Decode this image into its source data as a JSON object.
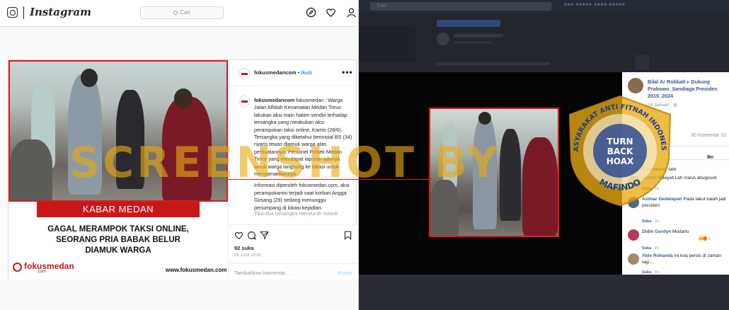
{
  "instagram": {
    "logo": "Instagram",
    "search_placeholder": "Cari",
    "post": {
      "username": "fokusmedancom",
      "follow_label": "Ikuti",
      "more_label": "•••",
      "banner": "KABAR MEDAN",
      "headline_lines": [
        "GAGAL MERAMPOK TAKSI ONLINE,",
        "SEORANG PRIA BABAK BELUR",
        "DIAMUK WARGA"
      ],
      "brand_name": "fokusmedan",
      "brand_tag": ".com",
      "brand_url": "www.fokusmedan.com",
      "caption_user": "fokusmedancom",
      "caption_text": "fokusmedan : Warga Jalan Alfalah Kecamatan Medan Timur lakukan aksi main hakim sendiri terhadap tersangka yang meakukan aksi perampokan taksi online, Kamis (28/6). Tersangka yang diketahui berinisial BS (34) nyaris tewas diamuk warga atas perbuatannya. Personel Polsek Medan Timur yang mendapat laporan adanya amuk warga langsung ke lokasi untuk mengamankannya.",
      "caption_text_2": "Informasi diperoleh fokusmedan.com, aksi perampokanini terjadi saat korban Angga Girsang (29) sedang menunggu penumpang di lokasi kejadian.",
      "caption_fade": "Tiba-tiba tersangka menyuruh masuk",
      "likes": "92 suka",
      "date": "28 JUNI 2018",
      "comment_placeholder": "Tambahkan komentar...",
      "send_label": "Kirim"
    }
  },
  "facebook": {
    "search_placeholder": "Cari",
    "panel": {
      "author": "Bilal Ar Robbah",
      "arrow": "▸",
      "target": "Dukung Prabowo_Sandiaga Presiden 2019_2024",
      "date": "14 Januari",
      "reaction_count": "915",
      "comments_count": "30 Komentar",
      "shares_count": "31",
      "like_label": "Suka",
      "share_label": "Be",
      "more_comments": "Lihat 15 komentar lain",
      "comments": [
        {
          "name": "Tohari Hidayat",
          "text": "Lah manA abugosok",
          "meta_like": "Suka",
          "meta_time": "1h",
          "color": "#7b6a55"
        },
        {
          "name": "Azimar Gedelapan",
          "text": "Pada takut kalah jadi presiden",
          "meta_like": "Suka",
          "meta_time": "1h",
          "color": "#4a6b8a"
        },
        {
          "name": "Didin Gordyn",
          "text": "Modarlu",
          "meta_like": "Suka",
          "meta_time": "1h",
          "reacts": "3",
          "color": "#b33a5a"
        },
        {
          "name": "Abie Rohanda",
          "text": "Ini koq persis di zaman lagi....",
          "meta_like": "Suka",
          "meta_time": "1h",
          "color": "#a58a6a"
        }
      ]
    }
  },
  "overlay": {
    "watermark": "SCREENSHOT BY",
    "seal_top": "MASYARAKAT ANTI FITNAH INDONESIA",
    "seal_bottom": "MAFINDO",
    "seal_center_1": "TURN",
    "seal_center_2": "BACK",
    "seal_center_3": "HOAX",
    "colors": {
      "accent_red": "#e0191c",
      "watermark_gold": "#e8aa12",
      "seal_blue": "#1d3f8f"
    }
  }
}
